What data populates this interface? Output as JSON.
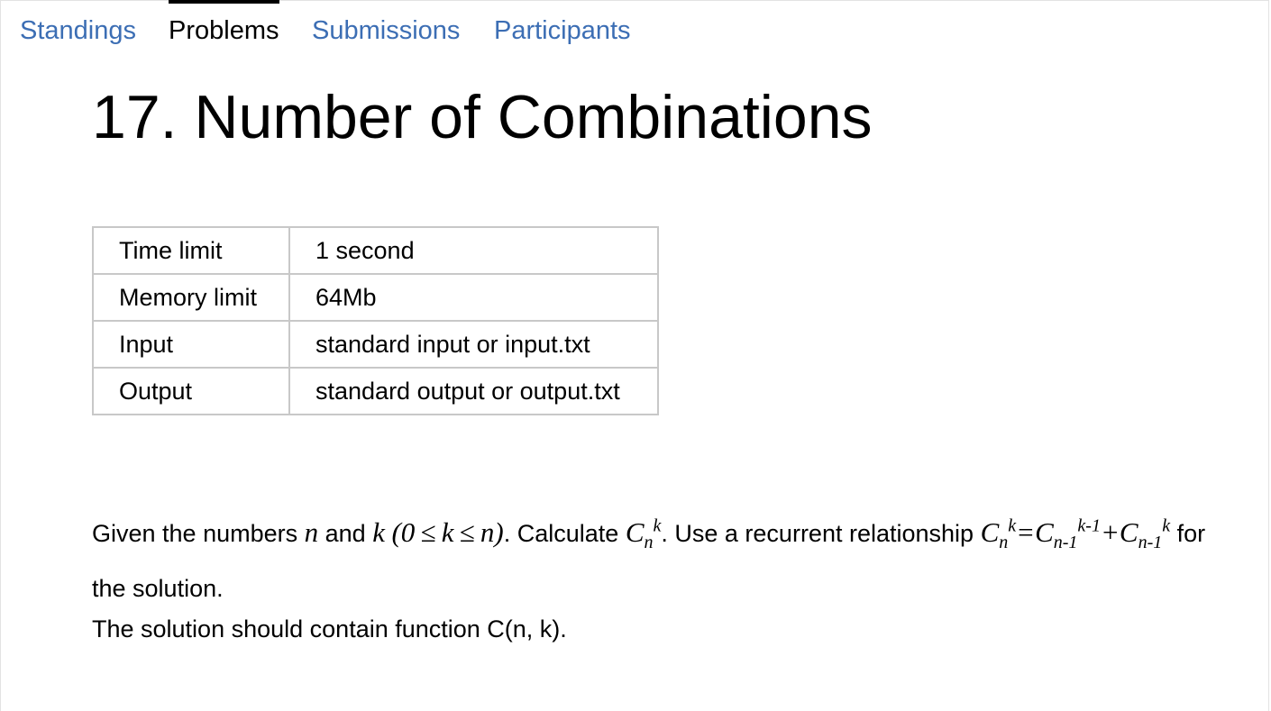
{
  "tabs": {
    "standings": "Standings",
    "problems": "Problems",
    "submissions": "Submissions",
    "participants": "Participants"
  },
  "problem": {
    "title": "17. Number of Combinations",
    "limits": [
      {
        "name": "Time limit",
        "value": "1 second"
      },
      {
        "name": "Memory limit",
        "value": "64Mb"
      },
      {
        "name": "Input",
        "value": "standard input or input.txt"
      },
      {
        "name": "Output",
        "value": "standard output or output.txt"
      }
    ],
    "statement": {
      "t1": "Given the numbers ",
      "var_n": "n",
      "t2": " and ",
      "var_k": "k",
      "cond": "(0 ≤ k ≤ n)",
      "t3": ". Calculate ",
      "C": "C",
      "sub_n": "n",
      "sup_k": "k",
      "t4": ". Use a recurrent relationship ",
      "eq": "=",
      "sub_n1": "n-1",
      "sup_k1": "k-1",
      "plus": "+",
      "sub_n1_b": "n-1",
      "sup_k_b": "k",
      "t5": " for the solution.",
      "p2": "The solution should contain function C(n, k)."
    }
  }
}
